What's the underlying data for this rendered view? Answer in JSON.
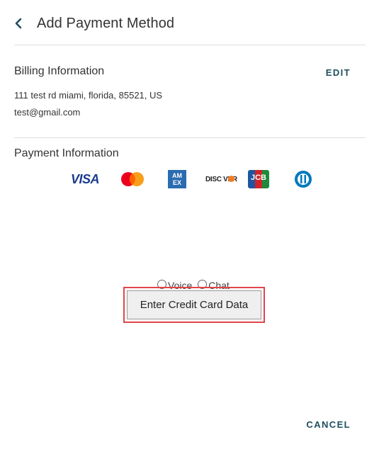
{
  "header": {
    "title": "Add Payment Method",
    "back_icon": "chevron-left-icon"
  },
  "billing": {
    "title": "Billing Information",
    "edit_label": "EDIT",
    "address": "111 test rd miami, florida, 85521, US",
    "email": "test@gmail.com"
  },
  "payment": {
    "title": "Payment Information",
    "card_brands": [
      {
        "name": "visa-icon",
        "text": "VISA"
      },
      {
        "name": "mastercard-icon"
      },
      {
        "name": "amex-icon",
        "text": "AM EX"
      },
      {
        "name": "discover-icon",
        "text": "DISC VER"
      },
      {
        "name": "jcb-icon",
        "text": "JCB"
      },
      {
        "name": "diners-club-icon"
      }
    ]
  },
  "contact_options": [
    "Voice",
    "Chat"
  ],
  "enter_card_button": "Enter Credit Card Data",
  "cancel_label": "CANCEL",
  "colors": {
    "accent": "#1e4e5f",
    "highlight_border": "#e0454a",
    "visa": "#1a3c8f",
    "amex": "#2b6cb0"
  }
}
